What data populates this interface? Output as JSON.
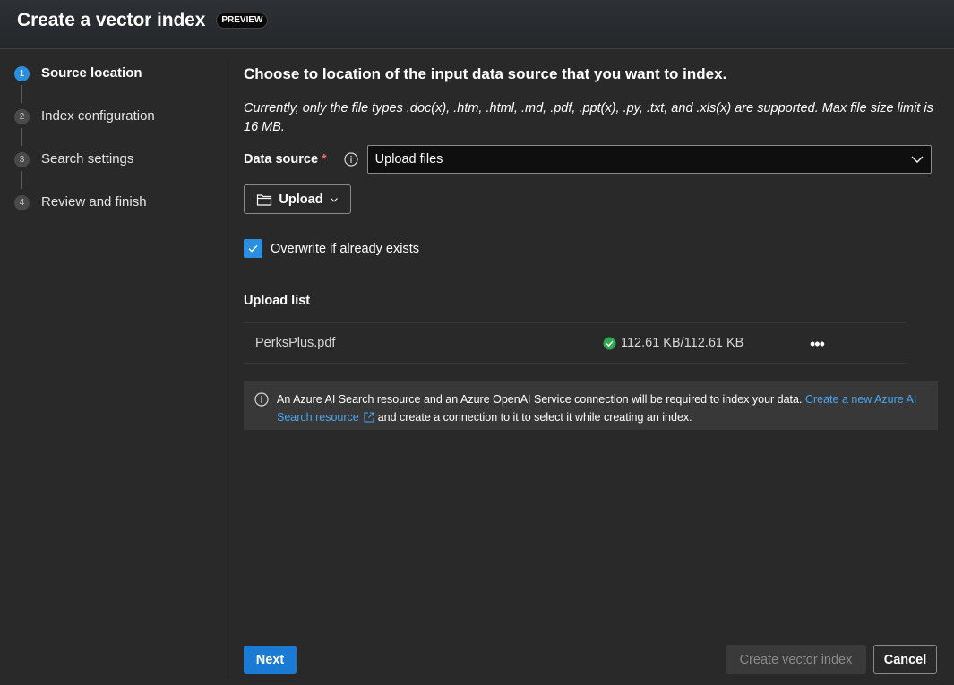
{
  "header": {
    "title": "Create a vector index",
    "badge": "PREVIEW"
  },
  "stepper": {
    "steps": [
      {
        "number": "1",
        "label": "Source location",
        "active": true
      },
      {
        "number": "2",
        "label": "Index configuration",
        "active": false
      },
      {
        "number": "3",
        "label": "Search settings",
        "active": false
      },
      {
        "number": "4",
        "label": "Review and finish",
        "active": false
      }
    ]
  },
  "main": {
    "title": "Choose to location of the input data source that you want to index.",
    "note": "Currently, only the file types .doc(x), .htm, .html, .md, .pdf, .ppt(x), .py, .txt, and .xls(x) are supported. Max file size limit is 16 MB.",
    "data_source": {
      "label": "Data source",
      "required_mark": "*",
      "selected": "Upload files"
    },
    "upload_button": "Upload",
    "overwrite": {
      "label": "Overwrite if already exists",
      "checked": true
    },
    "upload_list": {
      "title": "Upload list",
      "files": [
        {
          "name": "PerksPlus.pdf",
          "size": "112.61 KB/112.61 KB",
          "status": "success"
        }
      ]
    },
    "info": {
      "text1": "An Azure AI Search resource and an Azure OpenAI Service connection will be required to index your data.",
      "link": "Create a new Azure AI Search resource",
      "text2": "and create a connection to it to select it while creating an index."
    }
  },
  "footer": {
    "next": "Next",
    "create": "Create vector index",
    "cancel": "Cancel"
  },
  "colors": {
    "accent": "#2a8fe0",
    "success": "#2fa84f",
    "link": "#4aa5f0",
    "background": "#292929"
  }
}
